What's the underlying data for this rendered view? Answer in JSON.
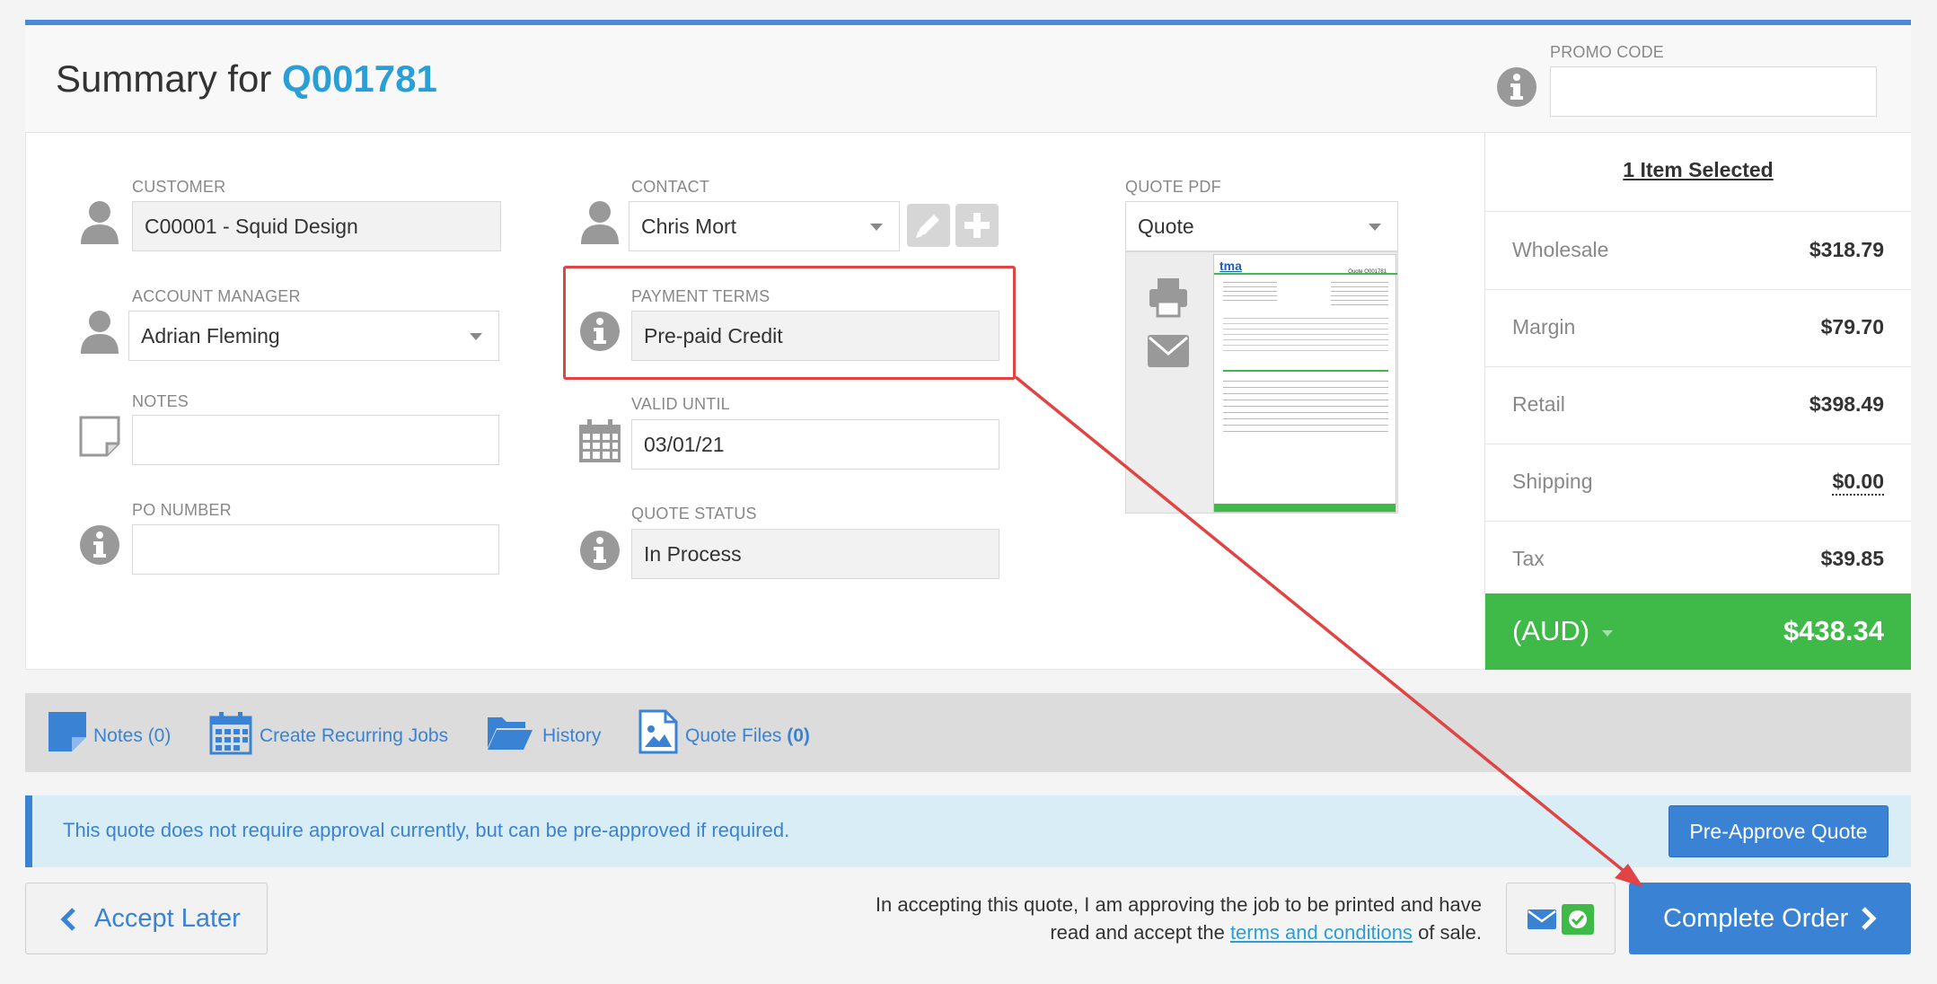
{
  "header": {
    "title_prefix": "Summary for",
    "quote_id": "Q001781",
    "promo_code_label": "PROMO CODE",
    "promo_code_value": ""
  },
  "form": {
    "customer": {
      "label": "CUSTOMER",
      "value": "C00001 - Squid Design"
    },
    "account_manager": {
      "label": "ACCOUNT MANAGER",
      "value": "Adrian Fleming"
    },
    "notes": {
      "label": "NOTES",
      "value": ""
    },
    "po_number": {
      "label": "PO NUMBER",
      "value": ""
    },
    "contact": {
      "label": "CONTACT",
      "value": "Chris Mort"
    },
    "payment_terms": {
      "label": "PAYMENT TERMS",
      "value": "Pre-paid Credit"
    },
    "valid_until": {
      "label": "VALID UNTIL",
      "value": "03/01/21"
    },
    "quote_status": {
      "label": "QUOTE STATUS",
      "value": "In Process"
    },
    "quote_pdf": {
      "label": "QUOTE PDF",
      "value": "Quote"
    }
  },
  "summary": {
    "items_selected": "1 Item Selected",
    "rows": [
      {
        "label": "Wholesale",
        "value": "$318.79"
      },
      {
        "label": "Margin",
        "value": "$79.70"
      },
      {
        "label": "Retail",
        "value": "$398.49"
      },
      {
        "label": "Shipping",
        "value": "$0.00"
      },
      {
        "label": "Tax",
        "value": "$39.85"
      }
    ],
    "currency": "(AUD)",
    "total": "$438.34"
  },
  "toolbar": {
    "notes": "Notes (0)",
    "recurring": "Create Recurring Jobs",
    "history": "History",
    "quote_files": "Quote Files",
    "quote_files_count": "(0)"
  },
  "approval": {
    "message": "This quote does not require approval currently, but can be pre-approved if required.",
    "button": "Pre-Approve Quote"
  },
  "footer": {
    "accept_later": "Accept Later",
    "terms_line1": "In accepting this quote, I am approving the job to be printed and have",
    "terms_line2_prefix": "read and accept the",
    "terms_link": "terms and conditions",
    "terms_line2_suffix": "of sale.",
    "complete_order": "Complete Order"
  },
  "pdf_thumb": {
    "brand": "tma",
    "doc_title": "Quote Q001781"
  },
  "colors": {
    "accent_blue": "#3a83d4",
    "link_blue": "#2a9fd6",
    "total_green": "#3fb948",
    "annotation_red": "#e04444"
  }
}
